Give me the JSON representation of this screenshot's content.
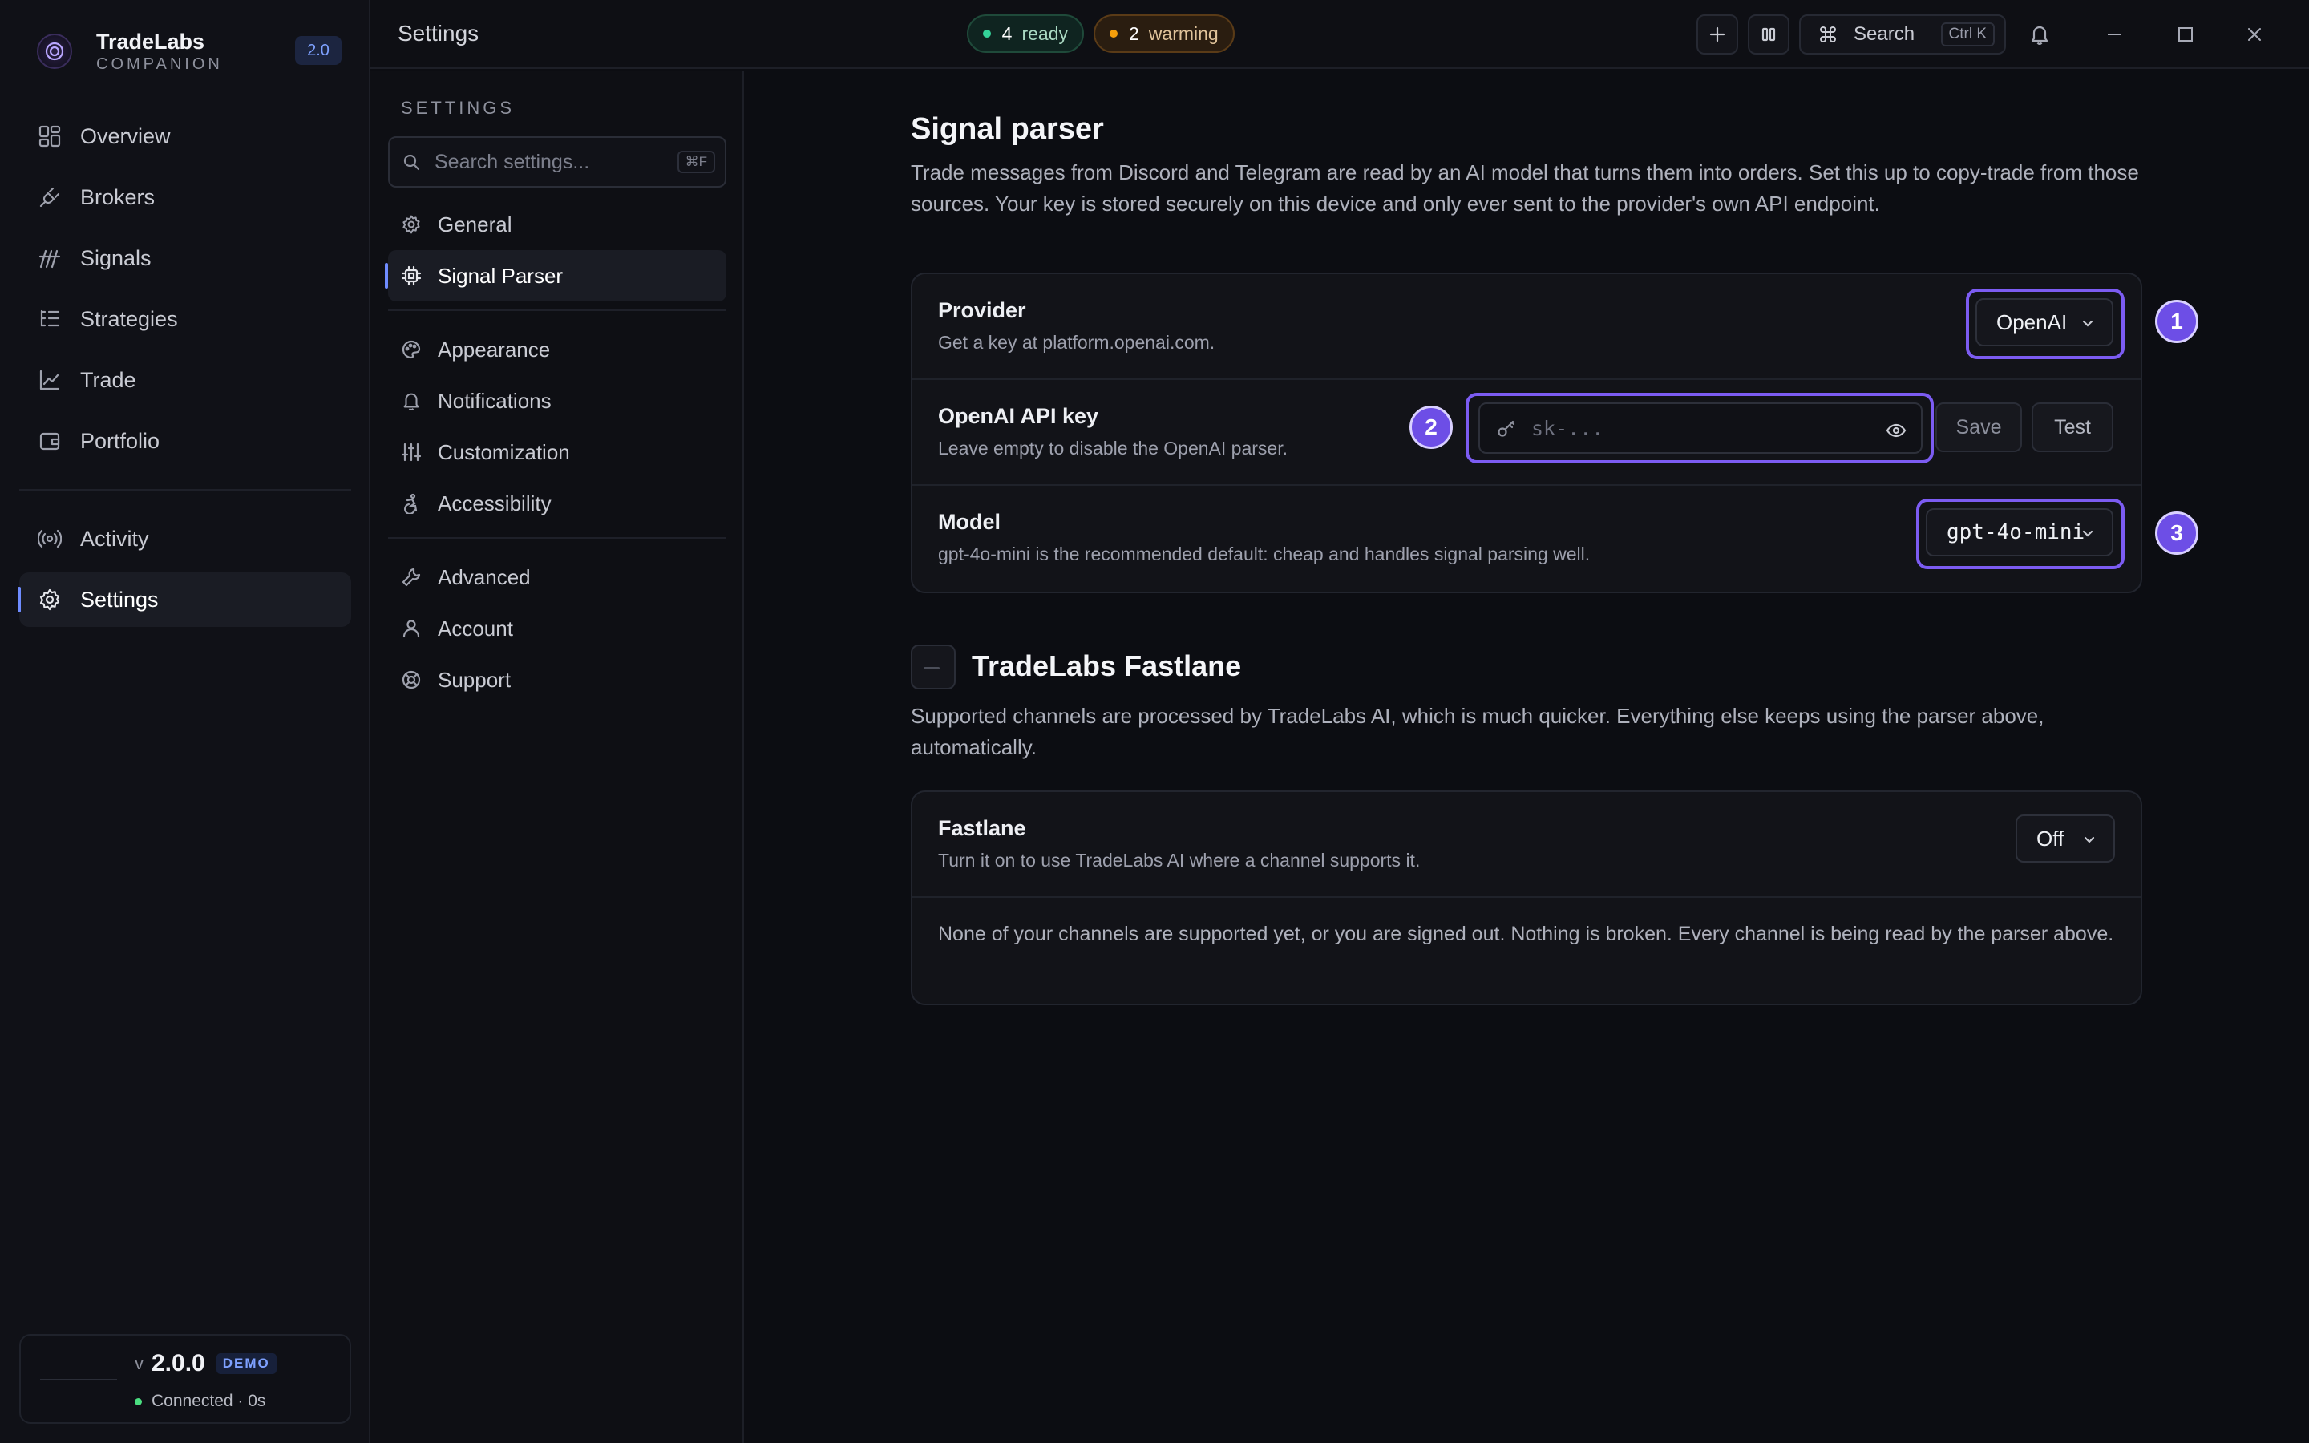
{
  "brand": {
    "name": "TradeLabs",
    "sub": "COMPANION",
    "version_badge": "2.0"
  },
  "sidebar": {
    "items": [
      {
        "label": "Overview",
        "icon": "grid-icon"
      },
      {
        "label": "Brokers",
        "icon": "plug-icon"
      },
      {
        "label": "Signals",
        "icon": "signal-icon"
      },
      {
        "label": "Strategies",
        "icon": "list-tree-icon"
      },
      {
        "label": "Trade",
        "icon": "chart-line-icon"
      },
      {
        "label": "Portfolio",
        "icon": "wallet-icon"
      }
    ],
    "items2": [
      {
        "label": "Activity",
        "icon": "radio-icon"
      },
      {
        "label": "Settings",
        "icon": "gear-icon",
        "active": true
      }
    ]
  },
  "status": {
    "v": "v",
    "version": "2.0.0",
    "badge": "DEMO",
    "connection": "Connected · 0s"
  },
  "topbar": {
    "title": "Settings",
    "ready_count": "4",
    "ready_label": "ready",
    "warming_count": "2",
    "warming_label": "warming",
    "search_label": "Search",
    "search_kbd": "Ctrl K"
  },
  "settings_nav": {
    "heading": "SETTINGS",
    "search_placeholder": "Search settings...",
    "search_kbd": "⌘F",
    "group1": [
      {
        "label": "General",
        "icon": "gear-icon"
      },
      {
        "label": "Signal Parser",
        "icon": "chip-icon",
        "active": true
      }
    ],
    "group2": [
      {
        "label": "Appearance",
        "icon": "palette-icon"
      },
      {
        "label": "Notifications",
        "icon": "bell-icon"
      },
      {
        "label": "Customization",
        "icon": "sliders-icon"
      },
      {
        "label": "Accessibility",
        "icon": "accessibility-icon"
      }
    ],
    "group3": [
      {
        "label": "Advanced",
        "icon": "wrench-icon"
      },
      {
        "label": "Account",
        "icon": "user-icon"
      },
      {
        "label": "Support",
        "icon": "lifebuoy-icon"
      }
    ]
  },
  "signal_parser": {
    "title": "Signal parser",
    "description": "Trade messages from Discord and Telegram are read by an AI model that turns them into orders. Set this up to copy-trade from those sources. Your key is stored securely on this device and only ever sent to the provider's own API endpoint.",
    "provider": {
      "title": "Provider",
      "sub": "Get a key at platform.openai.com.",
      "value": "OpenAI",
      "marker": "1"
    },
    "api_key": {
      "title": "OpenAI API key",
      "sub": "Leave empty to disable the OpenAI parser.",
      "placeholder": "sk-...",
      "save": "Save",
      "test": "Test",
      "marker": "2"
    },
    "model": {
      "title": "Model",
      "sub": "gpt-4o-mini is the recommended default: cheap and handles signal parsing well.",
      "value": "gpt-4o-mini",
      "marker": "3"
    }
  },
  "fastlane": {
    "title": "TradeLabs Fastlane",
    "description": "Supported channels are processed by TradeLabs AI, which is much quicker. Everything else keeps using the parser above, automatically.",
    "row_title": "Fastlane",
    "row_sub": "Turn it on to use TradeLabs AI where a channel supports it.",
    "value": "Off",
    "notice": "None of your channels are supported yet, or you are signed out. Nothing is broken. Every channel is being read by the parser above."
  },
  "colors": {
    "accent": "#7c5cf2",
    "ready": "#34d399",
    "warming": "#f59e0b",
    "connected": "#4ade80"
  }
}
